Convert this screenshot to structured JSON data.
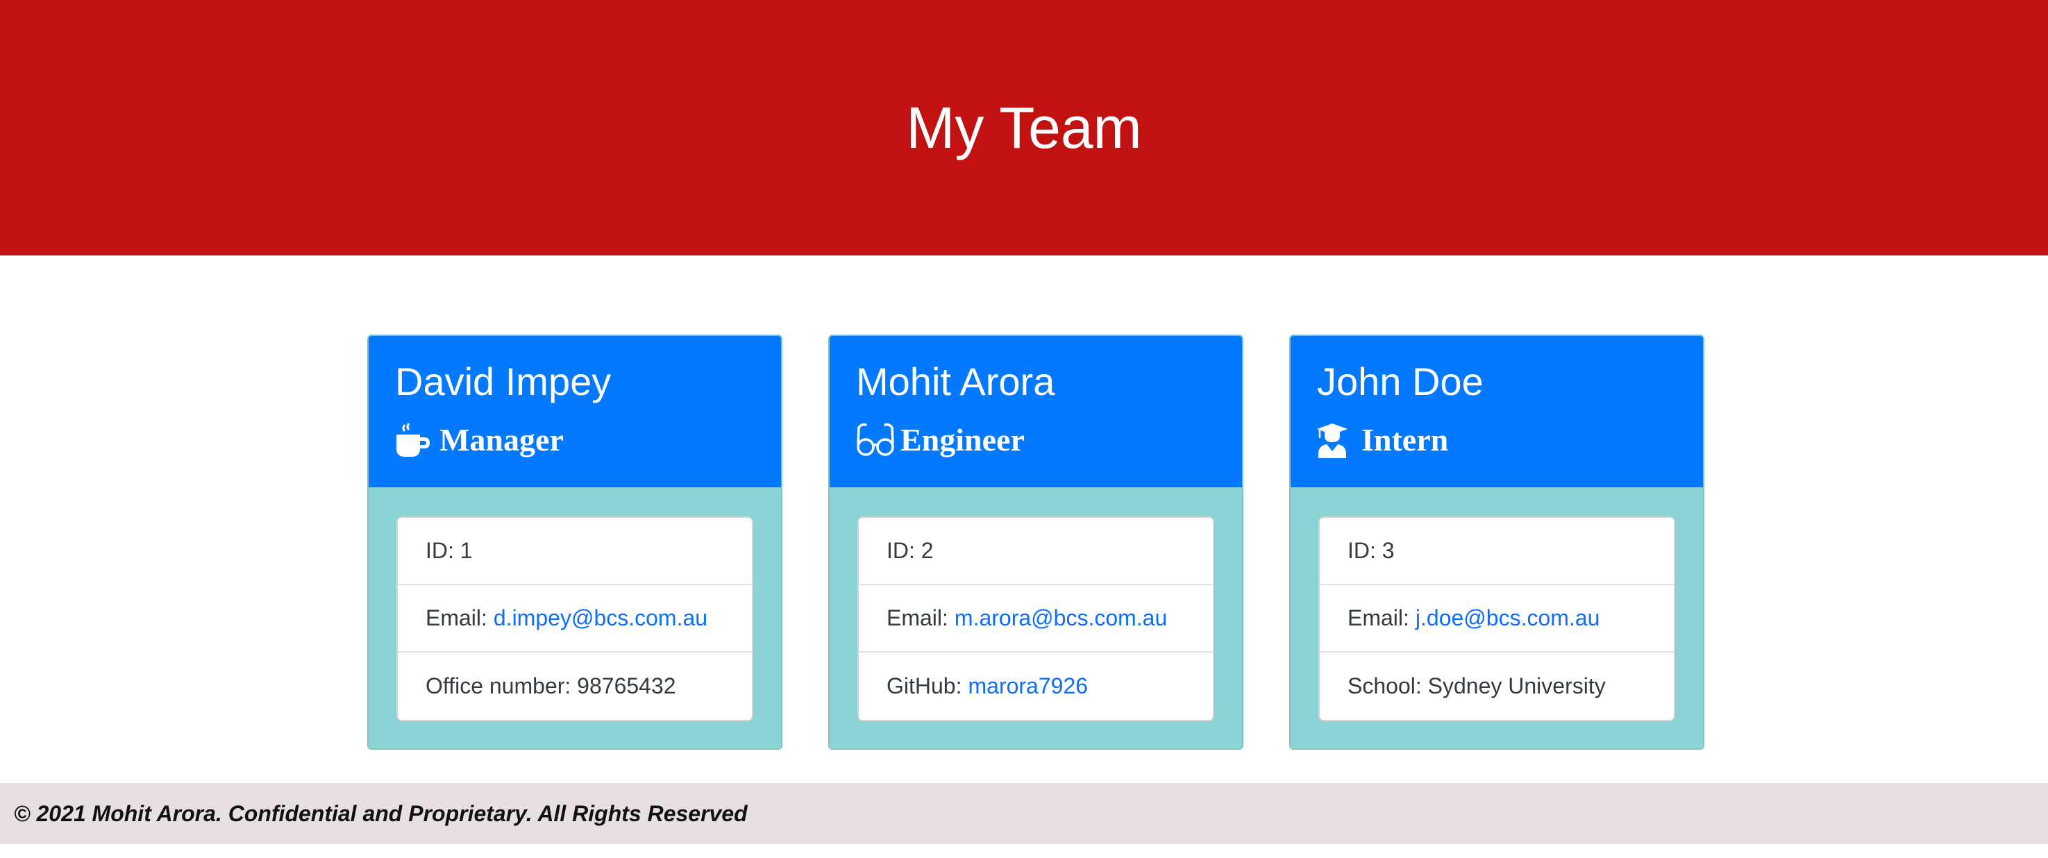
{
  "header": {
    "title": "My Team"
  },
  "cards": [
    {
      "name": "David Impey",
      "role": "Manager",
      "role_icon": "coffee-mug-icon",
      "id_text": "ID: 1",
      "email_label": "Email:",
      "email": "d.impey@bcs.com.au",
      "extra_label": "Office number: 98765432",
      "extra_link": ""
    },
    {
      "name": "Mohit Arora",
      "role": "Engineer",
      "role_icon": "glasses-icon",
      "id_text": "ID: 2",
      "email_label": "Email:",
      "email": "m.arora@bcs.com.au",
      "extra_label": "GitHub:",
      "extra_link": "marora7926"
    },
    {
      "name": "John Doe",
      "role": "Intern",
      "role_icon": "graduate-icon",
      "id_text": "ID: 3",
      "email_label": "Email:",
      "email": "j.doe@bcs.com.au",
      "extra_label": "School: Sydney University",
      "extra_link": ""
    }
  ],
  "colors": {
    "header_bg": "#c11111",
    "card_head_bg": "#0279ff",
    "card_body_bg": "#8ad4d6",
    "link": "#0d6efd",
    "footer_bg": "#e8dfe0"
  },
  "footer": {
    "text": "© 2021 Mohit Arora. Confidential and Proprietary. All Rights Reserved"
  }
}
